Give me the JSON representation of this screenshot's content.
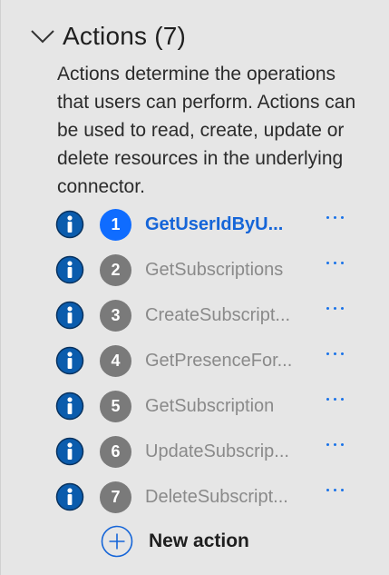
{
  "section": {
    "title": "Actions (7)",
    "chevron_icon": "chevron-down-icon",
    "description": "Actions determine the operations that users can perform. Actions can be used to read, create, update or delete resources in the underlying connector."
  },
  "actions": [
    {
      "number": "1",
      "name": "GetUserIdByU...",
      "active": true
    },
    {
      "number": "2",
      "name": "GetSubscriptions",
      "active": false
    },
    {
      "number": "3",
      "name": "CreateSubscript...",
      "active": false
    },
    {
      "number": "4",
      "name": "GetPresenceFor...",
      "active": false
    },
    {
      "number": "5",
      "name": "GetSubscription",
      "active": false
    },
    {
      "number": "6",
      "name": "UpdateSubscrip...",
      "active": false
    },
    {
      "number": "7",
      "name": "DeleteSubscript...",
      "active": false
    }
  ],
  "new_action": {
    "label": "New action",
    "icon": "plus-circle-icon"
  },
  "colors": {
    "panel_background": "#e6e6e6",
    "accent": "#0f6cff",
    "active_text": "#1565d8",
    "inactive_badge": "#7a7a7a",
    "inactive_text": "#8a8a8a",
    "info_icon": "#0b5cad"
  }
}
